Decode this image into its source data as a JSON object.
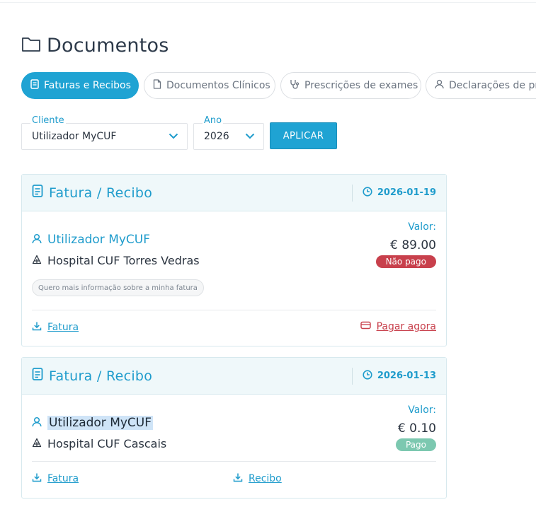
{
  "page": {
    "title": "Documentos"
  },
  "tabs": [
    {
      "label": "Faturas e Recibos",
      "icon": "receipt-icon",
      "active": true
    },
    {
      "label": "Documentos Clínicos",
      "icon": "document-icon",
      "active": false
    },
    {
      "label": "Prescrições de exames",
      "icon": "stethoscope-icon",
      "active": false
    },
    {
      "label": "Declarações de pr",
      "icon": "user-icon",
      "active": false
    }
  ],
  "filters": {
    "cliente": {
      "label": "Cliente",
      "value": "Utilizador MyCUF"
    },
    "ano": {
      "label": "Ano",
      "value": "2026"
    },
    "apply_label": "APLICAR"
  },
  "documents": [
    {
      "title": "Fatura / Recibo",
      "date": "2026-01-19",
      "user": "Utilizador MyCUF",
      "hospital": "Hospital CUF Torres Vedras",
      "valor_label": "Valor:",
      "amount": "€ 89.00",
      "status": "Não pago",
      "info_chip": "Quero mais informação sobre a minha fatura",
      "links": {
        "fatura": "Fatura",
        "pay": "Pagar agora"
      }
    },
    {
      "title": "Fatura / Recibo",
      "date": "2026-01-13",
      "user": "Utilizador MyCUF",
      "hospital": "Hospital CUF Cascais",
      "valor_label": "Valor:",
      "amount": "€ 0.10",
      "status": "Pago",
      "links": {
        "fatura": "Fatura",
        "recibo": "Recibo"
      }
    }
  ],
  "colors": {
    "accent": "#1fa3d3",
    "unpaid": "#c8404c",
    "paid": "#7cc8b0",
    "card_header": "#eff8fa"
  }
}
